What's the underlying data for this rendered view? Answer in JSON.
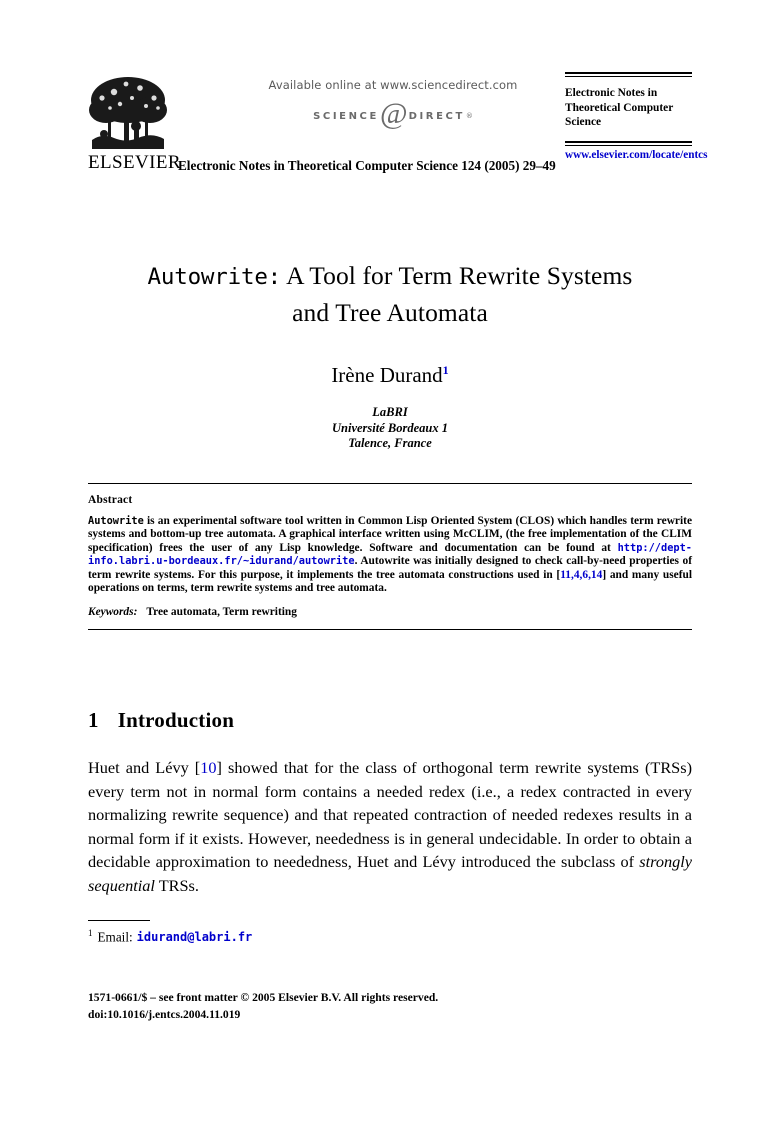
{
  "masthead": {
    "available_online": "Available online at www.sciencedirect.com",
    "sd_logo": {
      "left_word": "SCIENCE",
      "glyph": "@",
      "right_word": "DIRECT",
      "registered": "®"
    },
    "publisher_wordmark": "ELSEVIER",
    "journal_line": "Electronic Notes in Theoretical Computer Science 124 (2005) 29–49",
    "entcs_title": "Electronic Notes in Theoretical Computer Science",
    "entcs_url": "www.elsevier.com/locate/entcs"
  },
  "title": {
    "mono_part": "Autowrite:",
    "rest_line1": " A Tool for Term Rewrite Systems",
    "line2": "and Tree Automata"
  },
  "author": {
    "name": "Irène Durand",
    "footnote_marker": "1",
    "affiliation_lines": [
      "LaBRI",
      "Université Bordeaux 1",
      "Talence, France"
    ]
  },
  "abstract": {
    "heading": "Abstract",
    "text_part1_mono": "Autowrite",
    "text_part1": " is an experimental software tool written in Common Lisp Oriented System (CLOS) which handles term rewrite systems and bottom-up tree automata. A graphical interface written using McCLIM, (the free implementation of the CLIM specification) frees the user of any Lisp knowledge. Software and documentation can be found at ",
    "url": "http://dept-info.labri.u-bordeaux.fr/~idurand/autowrite",
    "text_part2": ". Autowrite was initially designed to check call-by-need properties of term rewrite systems. For this purpose, it implements the tree automata constructions used in [",
    "citations": "11,4,6,14",
    "text_part3": "] and many useful operations on terms, term rewrite systems and tree automata.",
    "keywords_label": "Keywords:",
    "keywords_value": "Tree automata, Term rewriting"
  },
  "section": {
    "number": "1",
    "heading": "Introduction",
    "paragraph_a": "Huet and Lévy [",
    "paragraph_cite": "10",
    "paragraph_b": "] showed that for the class of orthogonal term rewrite systems (TRSs) every term not in normal form contains a needed redex (i.e., a redex contracted in every normalizing rewrite sequence) and that repeated contraction of needed redexes results in a normal form if it exists. However, neededness is in general undecidable. In order to obtain a decidable approximation to neededness, Huet and Lévy introduced the subclass of ",
    "paragraph_italic": "strongly sequential",
    "paragraph_c": " TRSs."
  },
  "footnote": {
    "marker": "1",
    "label": "Email:",
    "email": "idurand@labri.fr"
  },
  "footer": {
    "line1": "1571-0661/$ – see front matter © 2005 Elsevier B.V. All rights reserved.",
    "line2": "doi:10.1016/j.entcs.2004.11.019"
  },
  "colors": {
    "link": "#0000cc",
    "logo_gray": "#6b6b6b",
    "text": "#000000"
  }
}
